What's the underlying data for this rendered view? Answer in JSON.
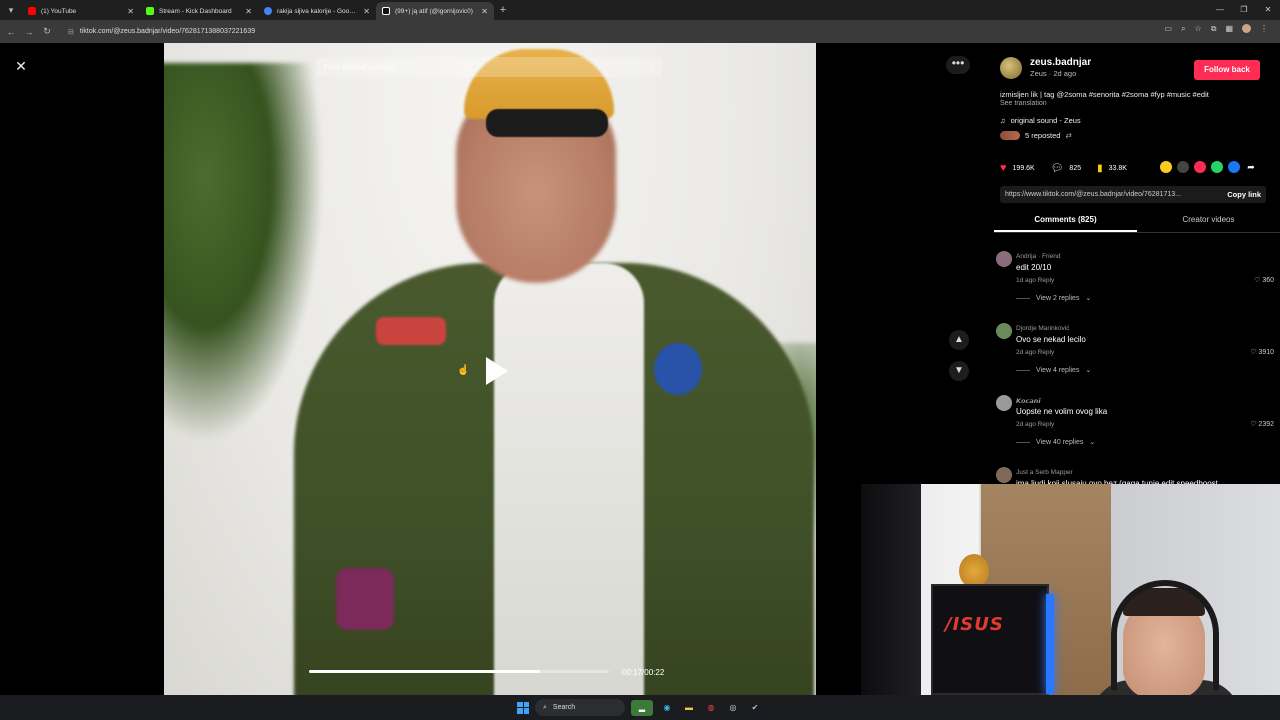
{
  "browser": {
    "tabs": [
      {
        "label": "(1) YouTube",
        "color": "#ff0000",
        "active": false
      },
      {
        "label": "Stream - Kick Dashboard",
        "color": "#53fc18",
        "active": false
      },
      {
        "label": "rakija sljiva kalorije - Google Se",
        "color": "#4285f4",
        "active": false
      },
      {
        "label": "(99+) ją atif (@igornijovic0)",
        "color": "#ffffff",
        "active": true
      }
    ],
    "url": "tiktok.com/@zeus.badnjar/video/7628171388037221639"
  },
  "video": {
    "search_placeholder": "Find related content",
    "time": "00:17/00:22",
    "progress_fraction": 0.77
  },
  "author": {
    "username": "zeus.badnjar",
    "subline": "Zeus · 2d ago",
    "follow_label": "Follow back",
    "description": "izmisljen lik | tag @2soma #senorita #2soma #fyp #music #edit",
    "translation": "See translation",
    "sound": "original sound - Zeus",
    "reposted": "5 reposted"
  },
  "stats": {
    "likes": "199.6K",
    "comments": "825",
    "saves": "33.8K"
  },
  "link": {
    "url": "https://www.tiktok.com/@zeus.badnjar/video/76281713...",
    "copy_label": "Copy link"
  },
  "comment_tabs": [
    "Comments (825)",
    "Creator videos"
  ],
  "comments": [
    {
      "user": "Andrija · Friend",
      "text": "edit 20/10",
      "meta": "1d ago   Reply",
      "likes": "360",
      "replies": "View 2 replies",
      "avatar_color": "#8a6d7d"
    },
    {
      "user": "Djordje Marinković",
      "text": "Ovo se nekad lecilo",
      "meta": "2d ago   Reply",
      "likes": "3910",
      "replies": "View 4 replies",
      "avatar_color": "#6b8a5a"
    },
    {
      "user": "𝙆𝙤𝙘𝙖𝙣𝙞",
      "text": "Uopste ne volim ovog lika",
      "meta": "2d ago   Reply",
      "likes": "2392",
      "replies": "View 40 replies",
      "avatar_color": "#9a9a9a"
    },
    {
      "user": "Just a Serb Mapper",
      "text": "ima ljudi koji slusaju ovo bez (gaga tunje edit speedboost",
      "meta": "",
      "likes": "",
      "replies": "",
      "avatar_color": "#7f6a5a"
    }
  ],
  "taskbar": {
    "search_label": "Search"
  }
}
